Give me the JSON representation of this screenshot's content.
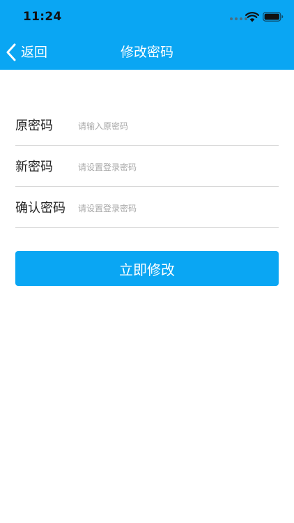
{
  "status_bar": {
    "time": "11:24"
  },
  "nav": {
    "back_label": "返回",
    "title": "修改密码"
  },
  "form": {
    "rows": [
      {
        "label": "原密码",
        "placeholder": "请输入原密码",
        "value": ""
      },
      {
        "label": "新密码",
        "placeholder": "请设置登录密码",
        "value": ""
      },
      {
        "label": "确认密码",
        "placeholder": "请设置登录密码",
        "value": ""
      }
    ]
  },
  "submit": {
    "label": "立即修改"
  },
  "colors": {
    "accent": "#0aa6f3",
    "divider": "#d8d8d8",
    "placeholder": "#a8a8a8"
  },
  "icons": {
    "back": "chevron-left-icon",
    "wifi": "wifi-icon",
    "battery": "battery-icon",
    "signal": "signal-dots-icon"
  }
}
